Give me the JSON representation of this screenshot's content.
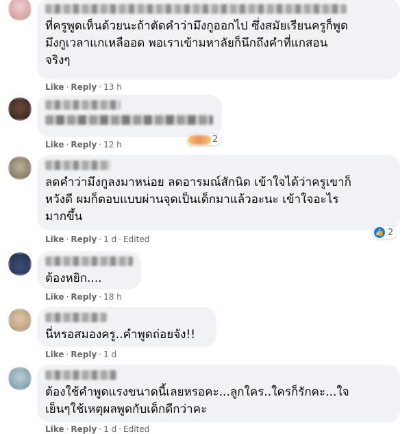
{
  "comments": [
    {
      "text": "ที่ครูพูดเห็นด้วยนะถ้าตัดคำว่ามึงกูออกไป ซึ่งสมัยเรียนครูก็พูด\nมึงกูเวลาแกเหลืออด พอเราเข้ามหาลัยก็นึกถึงคำที่แกสอน\nจริงๆ",
      "like": "Like",
      "reply": "Reply",
      "time": "13 h"
    },
    {
      "text": "",
      "like": "Like",
      "reply": "Reply",
      "time": "12 h",
      "reaction_count": "2"
    },
    {
      "text": "ลดคำว่ามึงกูลงมาหน่อย ลดอารมณ์สักนิด เข้าใจได้ว่าครูเขาก็\nหวังดี ผมก็ตอบแบบผ่านจุดเป็นเด็กมาแล้วอะนะ เข้าใจอะไร\nมากขึ้น",
      "like": "Like",
      "reply": "Reply",
      "time": "1 d",
      "edited": "Edited",
      "reaction_count": "2"
    },
    {
      "text": "ต้องหยิก....",
      "like": "Like",
      "reply": "Reply",
      "time": "18 h"
    },
    {
      "text": "นี่หรอสมองครู..คำพูดถ่อยจัง!!",
      "like": "Like",
      "reply": "Reply",
      "time": "1 d"
    },
    {
      "text": "ต้องใช้คำพูดแรงขนาดนี้เลยหรอคะ...ลูกใคร..ใครก็รักคะ...ใจ\nเย็นๆใช้เหตุผลพูดกับเด็กดีกว่าคะ",
      "like": "Like",
      "reply": "Reply",
      "time": "1 d",
      "edited": "Edited"
    }
  ],
  "colors": {
    "bubble": "#f0f2f5",
    "meta": "#65676b",
    "like_blue": "#1877f2"
  }
}
